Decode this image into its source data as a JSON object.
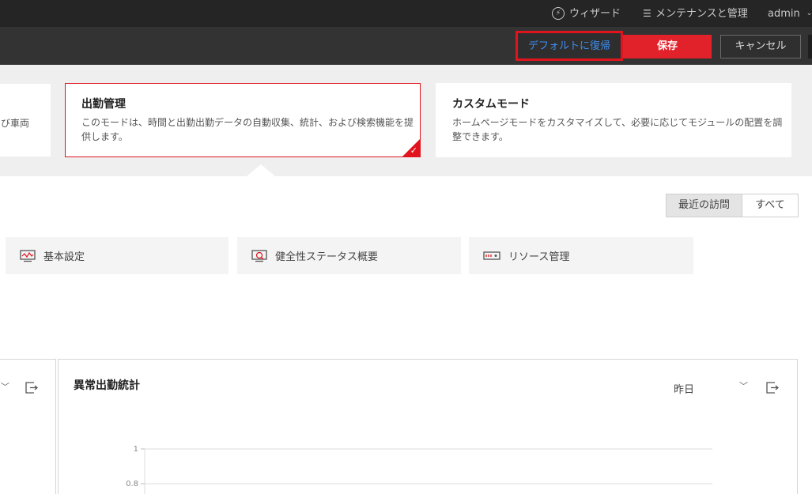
{
  "topbar": {
    "wizard_label": "ウィザード",
    "maintenance_label": "メンテナンスと管理",
    "user_label": "admin"
  },
  "actions": {
    "restore_label": "デフォルトに復帰",
    "save_label": "保存",
    "cancel_label": "キャンセル"
  },
  "modes": {
    "left_partial_desc": "び車両",
    "attendance": {
      "title": "出勤管理",
      "description": "このモードは、時間と出勤出勤データの自動収集、統計、および検索機能を提供します。",
      "selected": true
    },
    "custom": {
      "title": "カスタムモード",
      "description": "ホームページモードをカスタマイズして、必要に応じてモジュールの配置を調整できます。"
    }
  },
  "filter": {
    "recent_label": "最近の訪問",
    "all_label": "すべて",
    "selected": "最近の訪問"
  },
  "shortcuts": [
    {
      "label": "基本設定",
      "icon": "monitor-icon"
    },
    {
      "label": "健全性ステータス概要",
      "icon": "health-status-icon"
    },
    {
      "label": "リソース管理",
      "icon": "resource-device-icon"
    }
  ],
  "panel": {
    "title": "異常出勤統計",
    "period": "昨日"
  },
  "chart_data": {
    "type": "line",
    "title": "異常出勤統計",
    "yticks": [
      "1",
      "0.8"
    ],
    "ylim": [
      0,
      1
    ],
    "grid": true,
    "series": []
  },
  "colors": {
    "accent_red": "#e1141e",
    "link_blue": "#3d8ef0",
    "topbar_bg": "#252525"
  }
}
